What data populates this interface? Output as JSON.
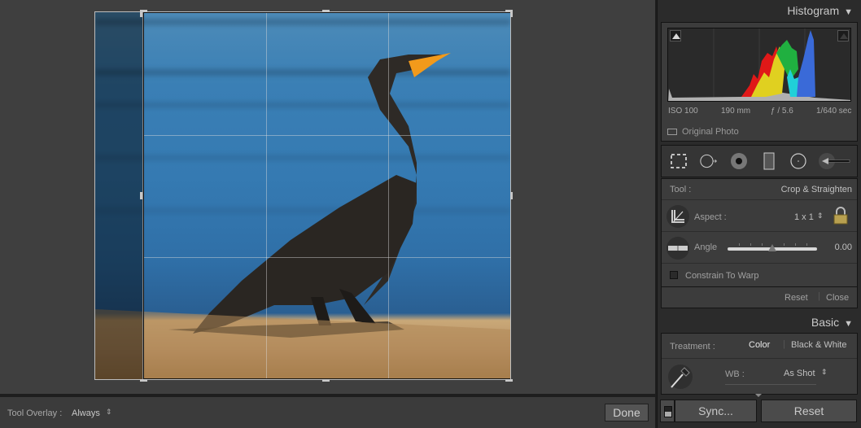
{
  "toolbar": {
    "overlay_label": "Tool Overlay :",
    "overlay_value": "Always",
    "done_label": "Done"
  },
  "histogram": {
    "title": "Histogram",
    "iso": "ISO 100",
    "focal": "190 mm",
    "aperture": "ƒ / 5.6",
    "shutter": "1/640 sec",
    "original_photo": "Original Photo"
  },
  "tools": [
    "crop-overlay",
    "spot-removal",
    "red-eye",
    "graduated-filter",
    "radial-filter",
    "adjustment-brush"
  ],
  "crop": {
    "tool_label": "Tool :",
    "tool_value": "Crop & Straighten",
    "aspect_label": "Aspect :",
    "aspect_value": "1 x 1",
    "aspect_locked": true,
    "angle_label": "Angle",
    "angle_value": "0.00",
    "angle_slider_fraction": 0.5,
    "constrain_label": "Constrain To Warp",
    "constrain_checked": false,
    "reset_label": "Reset",
    "close_label": "Close"
  },
  "basic": {
    "title": "Basic",
    "treatment_label": "Treatment :",
    "treatment_color": "Color",
    "treatment_bw": "Black & White",
    "wb_label": "WB :",
    "wb_value": "As Shot"
  },
  "footer": {
    "sync_label": "Sync...",
    "reset_label": "Reset"
  }
}
